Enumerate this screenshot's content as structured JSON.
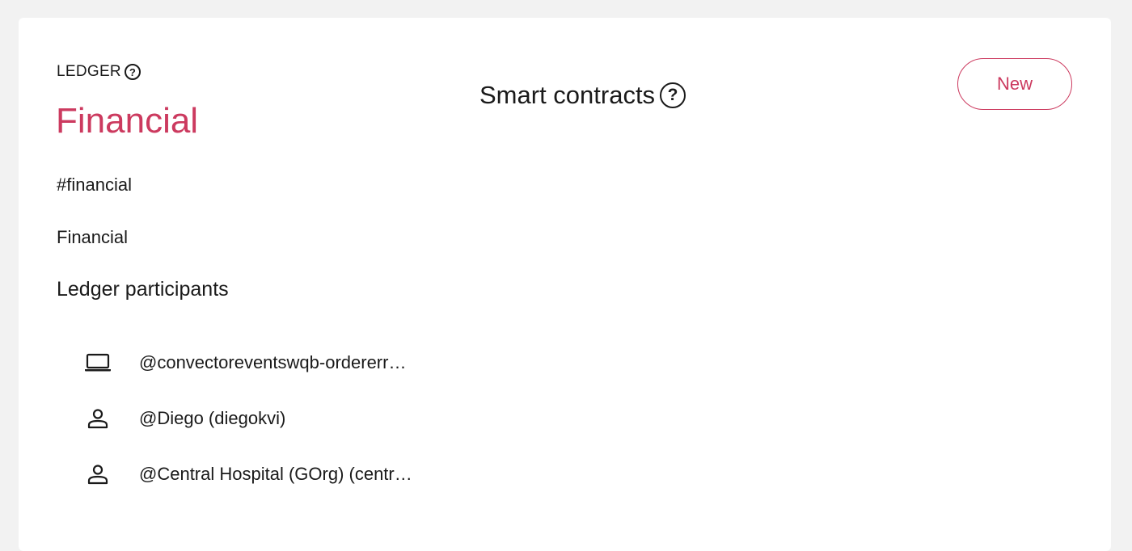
{
  "ledger": {
    "label": "LEDGER",
    "name": "Financial",
    "hashtag": "#financial",
    "description": "Financial"
  },
  "participants": {
    "heading": "Ledger participants",
    "items": [
      {
        "icon": "laptop-icon",
        "name": "@convectoreventswqb-ordererr…"
      },
      {
        "icon": "person-icon",
        "name": "@Diego (diegokvi)"
      },
      {
        "icon": "person-icon",
        "name": "@Central Hospital (GOrg) (centr…"
      }
    ]
  },
  "smart_contracts": {
    "title": "Smart contracts"
  },
  "actions": {
    "new_label": "New"
  },
  "colors": {
    "accent": "#cc3a5f",
    "background": "#f2f2f2",
    "card": "#ffffff"
  }
}
